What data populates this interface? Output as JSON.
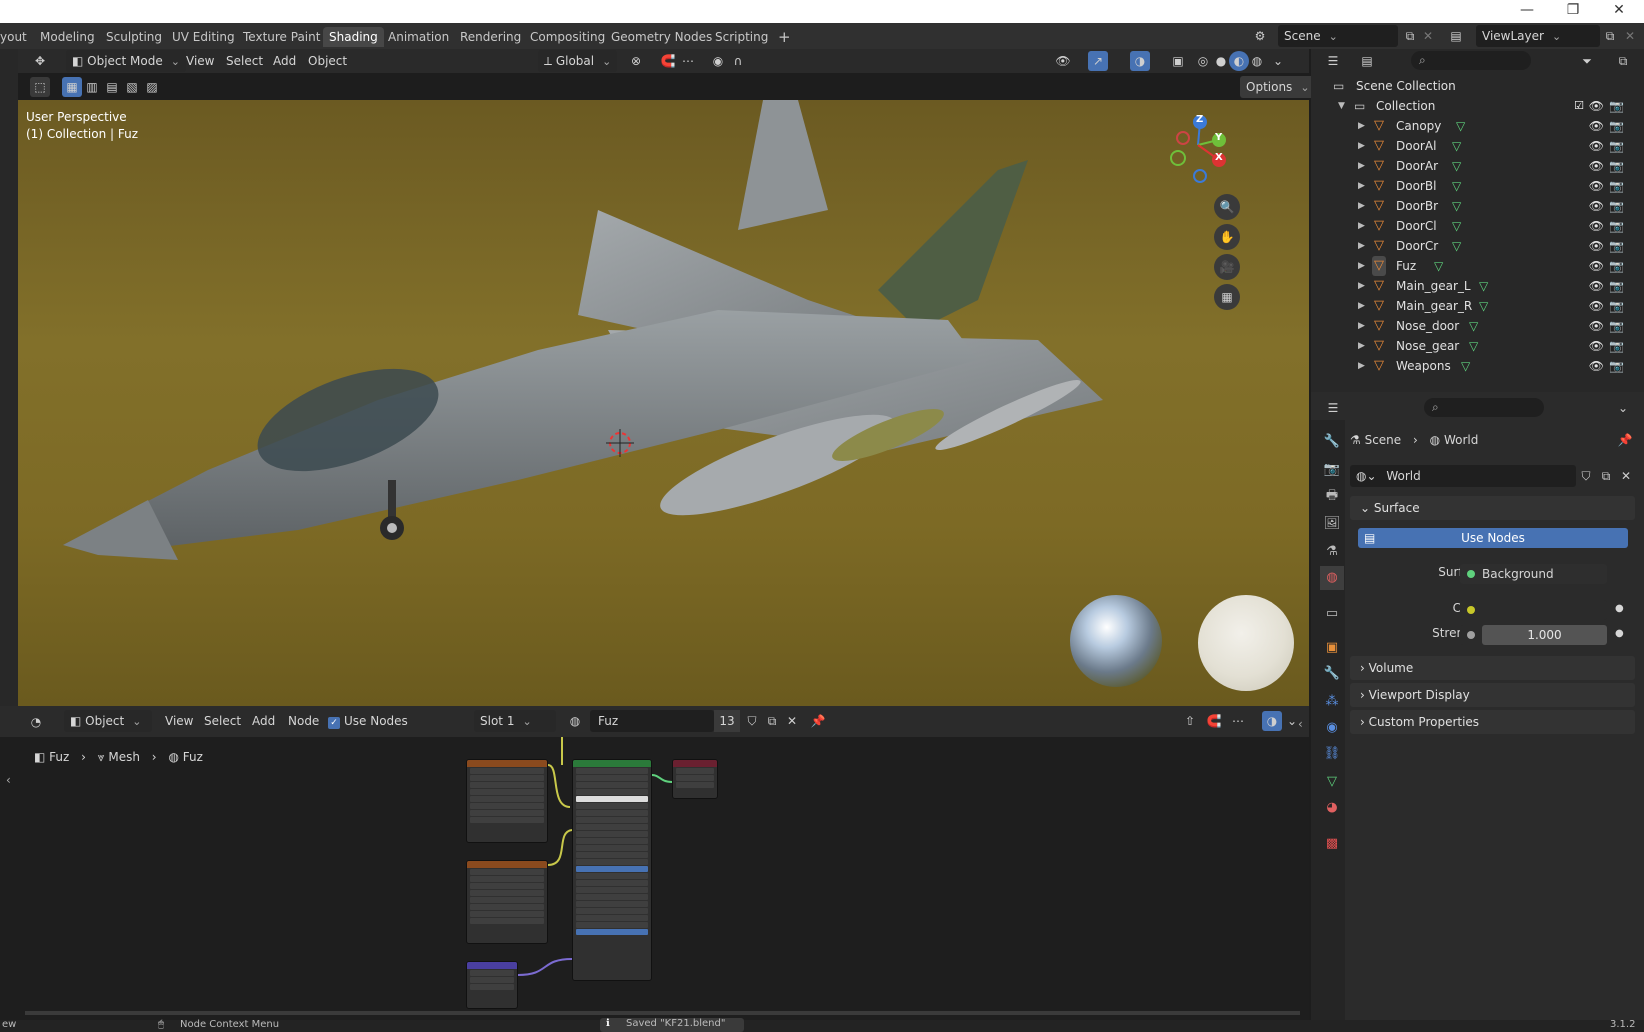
{
  "window": {
    "minimize": "—",
    "restore": "❐",
    "close": "✕"
  },
  "workspaces": {
    "tabs": [
      "yout",
      "Modeling",
      "Sculpting",
      "UV Editing",
      "Texture Paint",
      "Shading",
      "Animation",
      "Rendering",
      "Compositing",
      "Geometry Nodes",
      "Scripting"
    ],
    "active": "Shading",
    "add": "+"
  },
  "scene": {
    "label": "Scene",
    "viewlayer": "ViewLayer"
  },
  "viewport_header": {
    "mode": "Object Mode",
    "menus": [
      "View",
      "Select",
      "Add",
      "Object"
    ],
    "transform_orientation": "Global",
    "options": "Options"
  },
  "viewport": {
    "perspective": "User Perspective",
    "context": "(1) Collection | Fuz",
    "gizmo_axes": {
      "z": "Z",
      "y": "Y",
      "x": "X"
    }
  },
  "outliner": {
    "root": "Scene Collection",
    "collection": "Collection",
    "items": [
      "Canopy",
      "DoorAl",
      "DoorAr",
      "DoorBl",
      "DoorBr",
      "DoorCl",
      "DoorCr",
      "Fuz",
      "Main_gear_L",
      "Main_gear_R",
      "Nose_door",
      "Nose_gear",
      "Weapons"
    ]
  },
  "properties": {
    "breadcrumb": [
      "Scene",
      "World"
    ],
    "world_name": "World",
    "panels": {
      "surface": "Surface",
      "use_nodes": "Use Nodes",
      "surface_label": "Surface",
      "surface_value": "Background",
      "color_label": "Color",
      "strength_label": "Strength",
      "strength_value": "1.000",
      "volume": "Volume",
      "viewport_display": "Viewport Display",
      "custom_properties": "Custom Properties"
    }
  },
  "node_header": {
    "editor_type": "Object",
    "menus": [
      "View",
      "Select",
      "Add",
      "Node"
    ],
    "use_nodes": "Use Nodes",
    "slot": "Slot 1",
    "material": "Fuz",
    "users": "13"
  },
  "node_breadcrumb": [
    "Fuz",
    "Mesh",
    "Fuz"
  ],
  "status": {
    "left": "ew",
    "context_menu": "Node Context Menu",
    "saved": "Saved \"KF21.blend\"",
    "version": "3.1.2"
  },
  "colors": {
    "accent": "#4772b3",
    "active_tab": "#474747",
    "mesh_icon": "#e88a3a",
    "vdata_icon": "#5fd17d"
  }
}
